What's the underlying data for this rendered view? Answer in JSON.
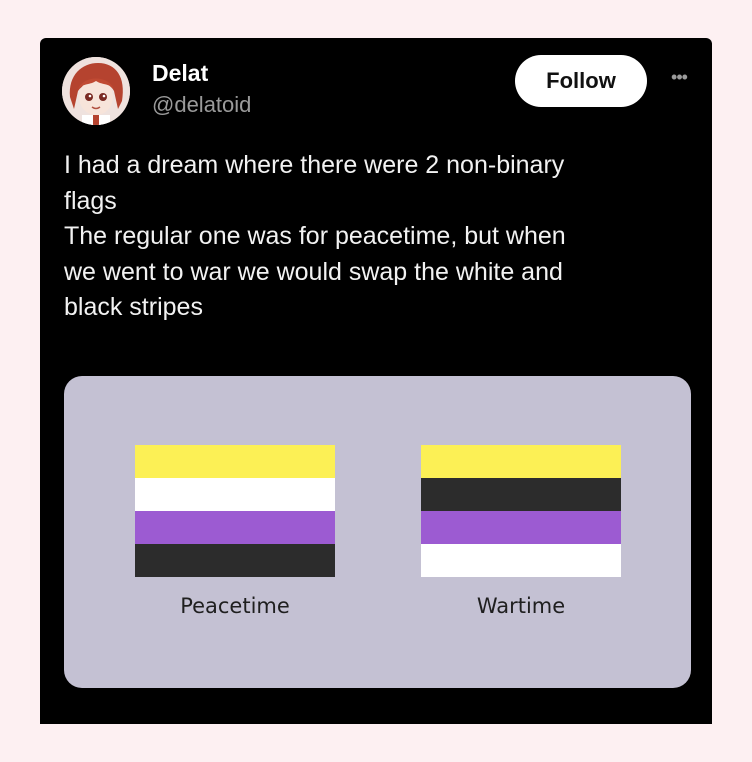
{
  "post": {
    "author": {
      "display_name": "Delat",
      "handle": "@delatoid",
      "avatar_icon": "anime-avatar-red-hair"
    },
    "follow_label": "Follow",
    "more_icon": "more-horizontal-icon",
    "text_lines": [
      "I had a dream where there were 2 non-binary",
      "flags",
      "The regular one was for peacetime, but when",
      "we went to war we would swap the white and",
      "black stripes"
    ]
  },
  "image": {
    "background": "#c4c1d3",
    "flags": [
      {
        "caption": "Peacetime",
        "stripes": [
          "#fcf055",
          "#ffffff",
          "#9c5bd2",
          "#2c2c2c"
        ]
      },
      {
        "caption": "Wartime",
        "stripes": [
          "#fcf055",
          "#2c2c2c",
          "#9c5bd2",
          "#ffffff"
        ]
      }
    ]
  },
  "colors": {
    "page_background": "#fdf0f2",
    "card_background": "#000000",
    "handle_text": "#9a9a9a",
    "follow_button_bg": "#ffffff"
  }
}
